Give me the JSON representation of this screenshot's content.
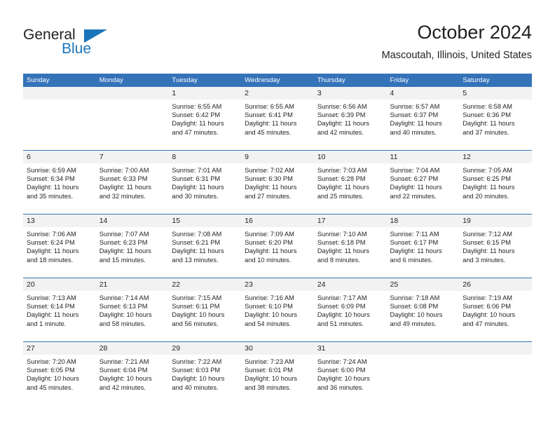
{
  "brand": {
    "name_part1": "General",
    "name_part2": "Blue"
  },
  "header": {
    "title": "October 2024",
    "subtitle": "Mascoutah, Illinois, United States"
  },
  "colors": {
    "header_blue": "#3573b9",
    "brand_blue": "#1b75bb",
    "day_band_gray": "#f2f2f2",
    "text": "#231f20"
  },
  "weekday_headers": [
    "Sunday",
    "Monday",
    "Tuesday",
    "Wednesday",
    "Thursday",
    "Friday",
    "Saturday"
  ],
  "weeks": [
    [
      {
        "day": "",
        "lines": []
      },
      {
        "day": "",
        "lines": []
      },
      {
        "day": "1",
        "lines": [
          "Sunrise: 6:55 AM",
          "Sunset: 6:42 PM",
          "Daylight: 11 hours",
          "and 47 minutes."
        ]
      },
      {
        "day": "2",
        "lines": [
          "Sunrise: 6:55 AM",
          "Sunset: 6:41 PM",
          "Daylight: 11 hours",
          "and 45 minutes."
        ]
      },
      {
        "day": "3",
        "lines": [
          "Sunrise: 6:56 AM",
          "Sunset: 6:39 PM",
          "Daylight: 11 hours",
          "and 42 minutes."
        ]
      },
      {
        "day": "4",
        "lines": [
          "Sunrise: 6:57 AM",
          "Sunset: 6:37 PM",
          "Daylight: 11 hours",
          "and 40 minutes."
        ]
      },
      {
        "day": "5",
        "lines": [
          "Sunrise: 6:58 AM",
          "Sunset: 6:36 PM",
          "Daylight: 11 hours",
          "and 37 minutes."
        ]
      }
    ],
    [
      {
        "day": "6",
        "lines": [
          "Sunrise: 6:59 AM",
          "Sunset: 6:34 PM",
          "Daylight: 11 hours",
          "and 35 minutes."
        ]
      },
      {
        "day": "7",
        "lines": [
          "Sunrise: 7:00 AM",
          "Sunset: 6:33 PM",
          "Daylight: 11 hours",
          "and 32 minutes."
        ]
      },
      {
        "day": "8",
        "lines": [
          "Sunrise: 7:01 AM",
          "Sunset: 6:31 PM",
          "Daylight: 11 hours",
          "and 30 minutes."
        ]
      },
      {
        "day": "9",
        "lines": [
          "Sunrise: 7:02 AM",
          "Sunset: 6:30 PM",
          "Daylight: 11 hours",
          "and 27 minutes."
        ]
      },
      {
        "day": "10",
        "lines": [
          "Sunrise: 7:03 AM",
          "Sunset: 6:28 PM",
          "Daylight: 11 hours",
          "and 25 minutes."
        ]
      },
      {
        "day": "11",
        "lines": [
          "Sunrise: 7:04 AM",
          "Sunset: 6:27 PM",
          "Daylight: 11 hours",
          "and 22 minutes."
        ]
      },
      {
        "day": "12",
        "lines": [
          "Sunrise: 7:05 AM",
          "Sunset: 6:25 PM",
          "Daylight: 11 hours",
          "and 20 minutes."
        ]
      }
    ],
    [
      {
        "day": "13",
        "lines": [
          "Sunrise: 7:06 AM",
          "Sunset: 6:24 PM",
          "Daylight: 11 hours",
          "and 18 minutes."
        ]
      },
      {
        "day": "14",
        "lines": [
          "Sunrise: 7:07 AM",
          "Sunset: 6:23 PM",
          "Daylight: 11 hours",
          "and 15 minutes."
        ]
      },
      {
        "day": "15",
        "lines": [
          "Sunrise: 7:08 AM",
          "Sunset: 6:21 PM",
          "Daylight: 11 hours",
          "and 13 minutes."
        ]
      },
      {
        "day": "16",
        "lines": [
          "Sunrise: 7:09 AM",
          "Sunset: 6:20 PM",
          "Daylight: 11 hours",
          "and 10 minutes."
        ]
      },
      {
        "day": "17",
        "lines": [
          "Sunrise: 7:10 AM",
          "Sunset: 6:18 PM",
          "Daylight: 11 hours",
          "and 8 minutes."
        ]
      },
      {
        "day": "18",
        "lines": [
          "Sunrise: 7:11 AM",
          "Sunset: 6:17 PM",
          "Daylight: 11 hours",
          "and 6 minutes."
        ]
      },
      {
        "day": "19",
        "lines": [
          "Sunrise: 7:12 AM",
          "Sunset: 6:15 PM",
          "Daylight: 11 hours",
          "and 3 minutes."
        ]
      }
    ],
    [
      {
        "day": "20",
        "lines": [
          "Sunrise: 7:13 AM",
          "Sunset: 6:14 PM",
          "Daylight: 11 hours",
          "and 1 minute."
        ]
      },
      {
        "day": "21",
        "lines": [
          "Sunrise: 7:14 AM",
          "Sunset: 6:13 PM",
          "Daylight: 10 hours",
          "and 58 minutes."
        ]
      },
      {
        "day": "22",
        "lines": [
          "Sunrise: 7:15 AM",
          "Sunset: 6:11 PM",
          "Daylight: 10 hours",
          "and 56 minutes."
        ]
      },
      {
        "day": "23",
        "lines": [
          "Sunrise: 7:16 AM",
          "Sunset: 6:10 PM",
          "Daylight: 10 hours",
          "and 54 minutes."
        ]
      },
      {
        "day": "24",
        "lines": [
          "Sunrise: 7:17 AM",
          "Sunset: 6:09 PM",
          "Daylight: 10 hours",
          "and 51 minutes."
        ]
      },
      {
        "day": "25",
        "lines": [
          "Sunrise: 7:18 AM",
          "Sunset: 6:08 PM",
          "Daylight: 10 hours",
          "and 49 minutes."
        ]
      },
      {
        "day": "26",
        "lines": [
          "Sunrise: 7:19 AM",
          "Sunset: 6:06 PM",
          "Daylight: 10 hours",
          "and 47 minutes."
        ]
      }
    ],
    [
      {
        "day": "27",
        "lines": [
          "Sunrise: 7:20 AM",
          "Sunset: 6:05 PM",
          "Daylight: 10 hours",
          "and 45 minutes."
        ]
      },
      {
        "day": "28",
        "lines": [
          "Sunrise: 7:21 AM",
          "Sunset: 6:04 PM",
          "Daylight: 10 hours",
          "and 42 minutes."
        ]
      },
      {
        "day": "29",
        "lines": [
          "Sunrise: 7:22 AM",
          "Sunset: 6:03 PM",
          "Daylight: 10 hours",
          "and 40 minutes."
        ]
      },
      {
        "day": "30",
        "lines": [
          "Sunrise: 7:23 AM",
          "Sunset: 6:01 PM",
          "Daylight: 10 hours",
          "and 38 minutes."
        ]
      },
      {
        "day": "31",
        "lines": [
          "Sunrise: 7:24 AM",
          "Sunset: 6:00 PM",
          "Daylight: 10 hours",
          "and 36 minutes."
        ]
      },
      {
        "day": "",
        "lines": []
      },
      {
        "day": "",
        "lines": []
      }
    ]
  ]
}
